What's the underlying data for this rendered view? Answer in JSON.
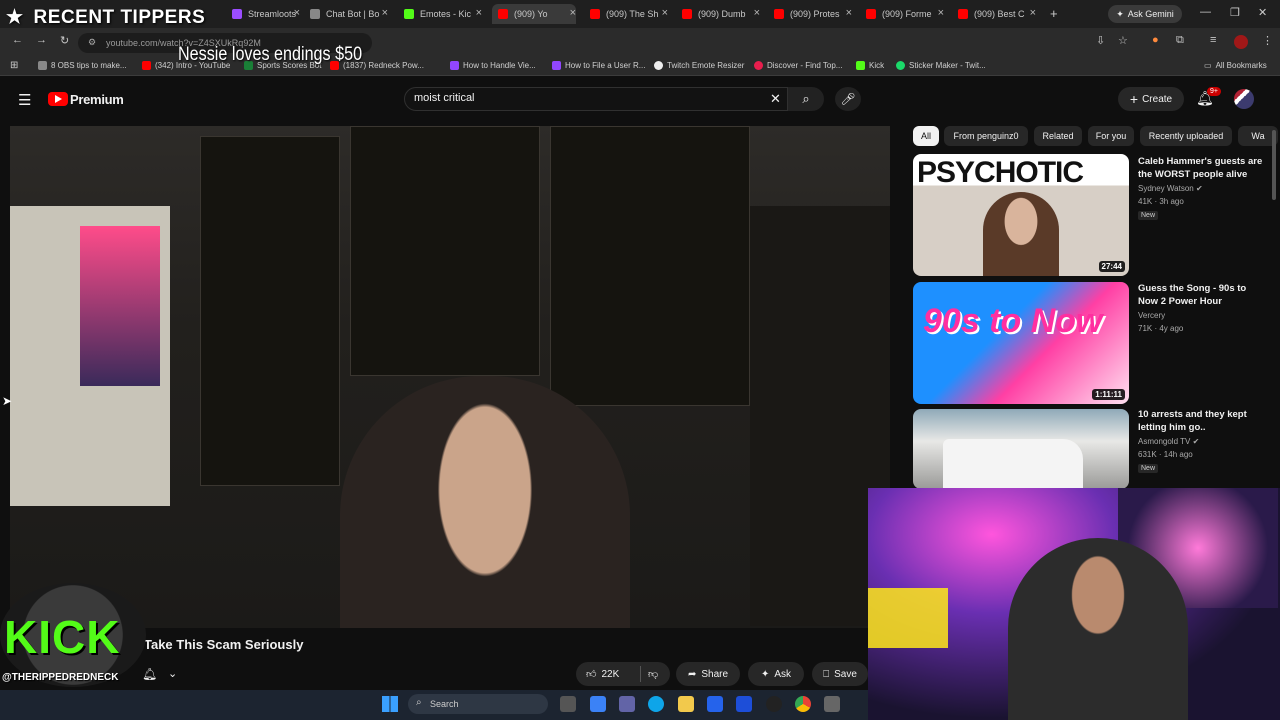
{
  "browser": {
    "tabs": [
      {
        "label": "Streamloots",
        "color": "#9b4dff"
      },
      {
        "label": "Chat Bot | Bo",
        "color": "#888888"
      },
      {
        "label": "Emotes - Kic",
        "color": "#53fc18"
      },
      {
        "label": "(909) Yo",
        "color": "#ff0000",
        "active": true
      },
      {
        "label": "(909) The Sh",
        "color": "#ff0000"
      },
      {
        "label": "(909) Dumb",
        "color": "#ff0000"
      },
      {
        "label": "(909) Protes",
        "color": "#ff0000"
      },
      {
        "label": "(909) Forme",
        "color": "#ff0000"
      },
      {
        "label": "(909) Best C",
        "color": "#ff0000"
      }
    ],
    "new_tab": "+",
    "ask_gemini": "Ask Gemini",
    "url": "youtube.com/watch?v=Z4SXUkRq92M",
    "bookmarks": [
      "8 OBS tips to make...",
      "(342) Intro - YouTube",
      "Sports Scores Bot",
      "(1837) Redneck Pow...",
      "How to Handle Vie...",
      "How to File a User R...",
      "Twitch Emote Resizer",
      "Discover - Find Top...",
      "Kick",
      "Sticker Maker - Twit..."
    ],
    "all_bookmarks": "All Bookmarks"
  },
  "youtube": {
    "logo_text": "Premium",
    "search_query": "moist critical",
    "create_label": "Create",
    "notif_count": "9+",
    "video_title": "Take This Scam Seriously",
    "likes": "22K",
    "share_label": "Share",
    "ask_label": "Ask",
    "save_label": "Save",
    "chips": [
      "All",
      "From penguinz0",
      "Related",
      "For you",
      "Recently uploaded",
      "Wa"
    ],
    "recommendations": [
      {
        "title": "Caleb Hammer's guests are the WORST people alive",
        "channel": "Sydney Watson",
        "meta": "41K · 3h ago",
        "badge": "New",
        "duration": "27:44",
        "thumb_text": "PSYCHOTIC"
      },
      {
        "title": "Guess the Song - 90s to Now 2 Power Hour",
        "channel": "Vercery",
        "meta": "71K · 4y ago",
        "badge": "",
        "duration": "1:11:11",
        "thumb_text": "90s to Now"
      },
      {
        "title": "10 arrests and they kept letting him go..",
        "channel": "Asmongold TV",
        "meta": "631K · 14h ago",
        "badge": "New",
        "duration": "",
        "thumb_text": ""
      }
    ]
  },
  "overlay": {
    "recent_tippers": "RECENT TIPPERS",
    "tip_message": "Nessie loves endings $50",
    "kick_text": "KICK",
    "kick_handle": "@THERIPPEDREDNECK"
  },
  "taskbar": {
    "search_placeholder": "Search"
  }
}
